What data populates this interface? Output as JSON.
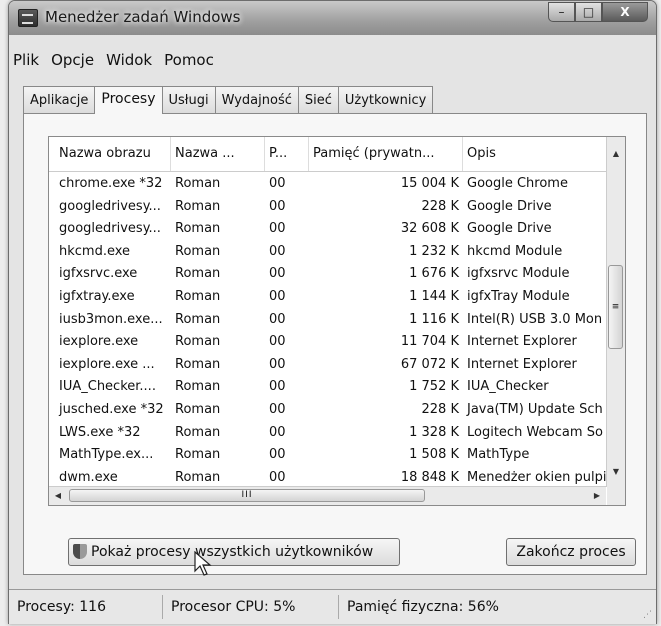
{
  "window": {
    "title": "Menedżer zadań Windows",
    "controls": {
      "minimize": "–",
      "maximize": "□",
      "close": "X"
    }
  },
  "menu": [
    "Plik",
    "Opcje",
    "Widok",
    "Pomoc"
  ],
  "tabs": [
    {
      "label": "Aplikacje",
      "active": false
    },
    {
      "label": "Procesy",
      "active": true
    },
    {
      "label": "Usługi",
      "active": false
    },
    {
      "label": "Wydajność",
      "active": false
    },
    {
      "label": "Sieć",
      "active": false
    },
    {
      "label": "Użytkownicy",
      "active": false
    }
  ],
  "processes": {
    "columns": [
      "Nazwa obrazu",
      "Nazwa ...",
      "P...",
      "Pamięć (prywatn...",
      "Opis"
    ],
    "rows": [
      [
        "chrome.exe *32",
        "Roman",
        "00",
        "15 004 K",
        "Google Chrome"
      ],
      [
        "googledrivesy...",
        "Roman",
        "00",
        "228 K",
        "Google Drive"
      ],
      [
        "googledrivesy...",
        "Roman",
        "00",
        "32 608 K",
        "Google Drive"
      ],
      [
        "hkcmd.exe",
        "Roman",
        "00",
        "1 232 K",
        "hkcmd Module"
      ],
      [
        "igfxsrvc.exe",
        "Roman",
        "00",
        "1 676 K",
        "igfxsrvc Module"
      ],
      [
        "igfxtray.exe",
        "Roman",
        "00",
        "1 144 K",
        "igfxTray Module"
      ],
      [
        "iusb3mon.exe...",
        "Roman",
        "00",
        "1 116 K",
        "Intel(R) USB 3.0 Mon"
      ],
      [
        "iexplore.exe",
        "Roman",
        "00",
        "11 704 K",
        "Internet Explorer"
      ],
      [
        "iexplore.exe ...",
        "Roman",
        "00",
        "67 072 K",
        "Internet Explorer"
      ],
      [
        "IUA_Checker....",
        "Roman",
        "00",
        "1 752 K",
        "IUA_Checker"
      ],
      [
        "jusched.exe *32",
        "Roman",
        "00",
        "228 K",
        "Java(TM) Update Sch"
      ],
      [
        "LWS.exe *32",
        "Roman",
        "00",
        "1 328 K",
        "Logitech Webcam So"
      ],
      [
        "MathType.ex...",
        "Roman",
        "00",
        "1 508 K",
        "MathType"
      ],
      [
        "dwm.exe",
        "Roman",
        "00",
        "18 848 K",
        "Menedżer okien pulpi"
      ]
    ],
    "scroll": {
      "up": "▲",
      "down": "▼",
      "left": "◀",
      "right": "▶",
      "vgrip": "≡",
      "hgrip": "III"
    }
  },
  "buttons": {
    "show_all": "Pokaż procesy wszystkich użytkowników",
    "end_process": "Zakończ proces"
  },
  "status": {
    "processes": "Procesy: 116",
    "cpu": "Procesor CPU: 5%",
    "memory": "Pamięć fizyczna: 56%"
  }
}
